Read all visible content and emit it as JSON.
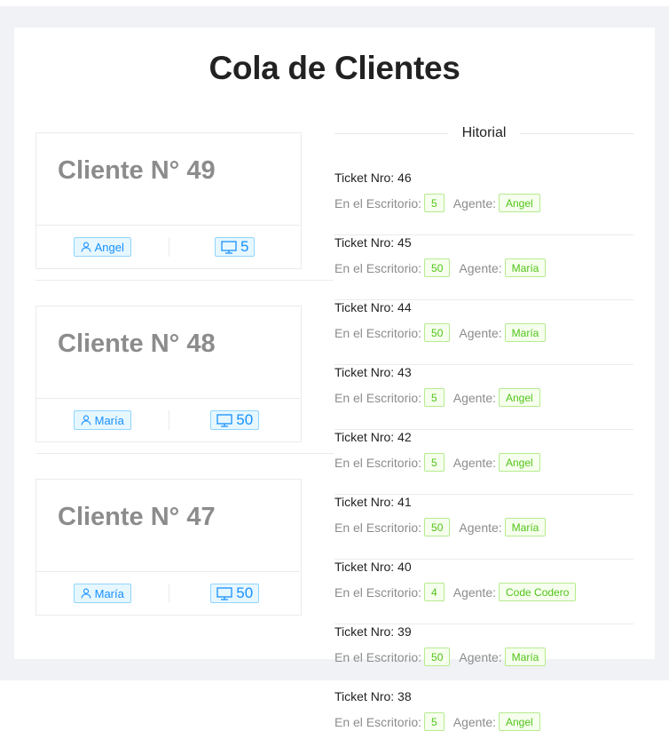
{
  "page": {
    "title": "Cola de Clientes"
  },
  "queue": [
    {
      "title": "Cliente N° 49",
      "agent": "Angel",
      "desk": "5"
    },
    {
      "title": "Cliente N° 48",
      "agent": "María",
      "desk": "50"
    },
    {
      "title": "Cliente N° 47",
      "agent": "María",
      "desk": "50"
    }
  ],
  "history": {
    "heading": "Hitorial",
    "desk_label": "En el Escritorio:",
    "agent_label": "Agente:",
    "items": [
      {
        "ticket": "Ticket Nro: 46",
        "desk": "5",
        "agent": "Angel"
      },
      {
        "ticket": "Ticket Nro: 45",
        "desk": "50",
        "agent": "María"
      },
      {
        "ticket": "Ticket Nro: 44",
        "desk": "50",
        "agent": "María"
      },
      {
        "ticket": "Ticket Nro: 43",
        "desk": "5",
        "agent": "Angel"
      },
      {
        "ticket": "Ticket Nro: 42",
        "desk": "5",
        "agent": "Angel"
      },
      {
        "ticket": "Ticket Nro: 41",
        "desk": "50",
        "agent": "María"
      },
      {
        "ticket": "Ticket Nro: 40",
        "desk": "4",
        "agent": "Code Codero"
      },
      {
        "ticket": "Ticket Nro: 39",
        "desk": "50",
        "agent": "María"
      },
      {
        "ticket": "Ticket Nro: 38",
        "desk": "5",
        "agent": "Angel"
      }
    ]
  },
  "icons": {
    "agent": "user-icon",
    "desk": "desktop-icon"
  },
  "colors": {
    "tag_blue": "#1890ff",
    "tag_green": "#52c41a",
    "page_bg": "#f0f2f5"
  }
}
